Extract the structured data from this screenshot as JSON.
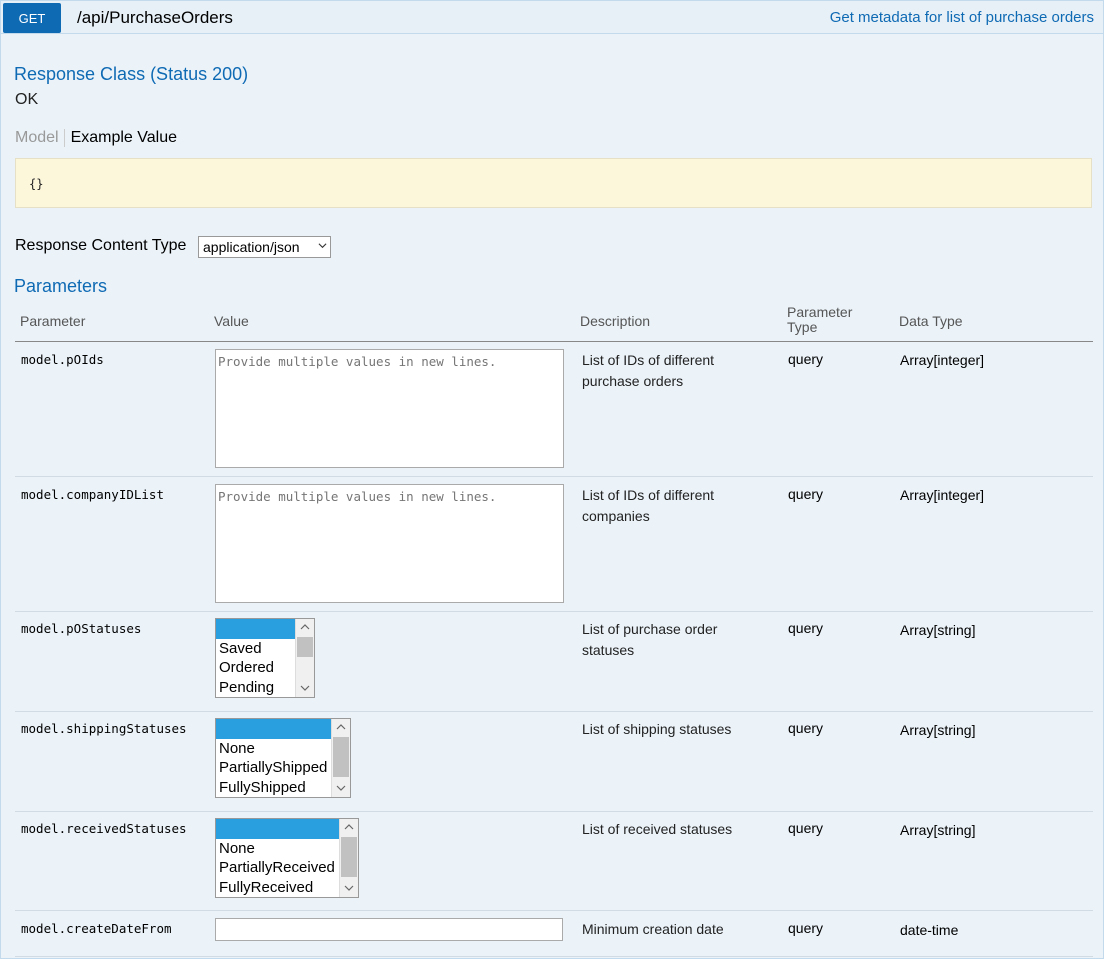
{
  "endpoint": {
    "method": "GET",
    "path": "/api/PurchaseOrders",
    "summary": "Get metadata for list of purchase orders"
  },
  "response_class": {
    "title": "Response Class (Status 200)",
    "status_text": "OK",
    "tab_model": "Model",
    "tab_example": "Example Value",
    "example_value": "{}"
  },
  "response_content_type": {
    "label": "Response Content Type",
    "selected": "application/json"
  },
  "parameters": {
    "title": "Parameters",
    "headers": {
      "parameter": "Parameter",
      "value": "Value",
      "description": "Description",
      "parameter_type_1": "Parameter",
      "parameter_type_2": "Type",
      "data_type": "Data Type"
    },
    "rows": [
      {
        "name": "model.pOIds",
        "placeholder": "Provide multiple values in new lines.",
        "description": "List of IDs of different purchase orders",
        "param_type": "query",
        "data_type": "Array[integer]"
      },
      {
        "name": "model.companyIDList",
        "placeholder": "Provide multiple values in new lines.",
        "description": "List of IDs of different companies",
        "param_type": "query",
        "data_type": "Array[integer]"
      },
      {
        "name": "model.pOStatuses",
        "options": [
          "",
          "Saved",
          "Ordered",
          "Pending"
        ],
        "description": "List of purchase order statuses",
        "param_type": "query",
        "data_type": "Array[string]"
      },
      {
        "name": "model.shippingStatuses",
        "options": [
          "",
          "None",
          "PartiallyShipped",
          "FullyShipped"
        ],
        "description": "List of shipping statuses",
        "param_type": "query",
        "data_type": "Array[string]"
      },
      {
        "name": "model.receivedStatuses",
        "options": [
          "",
          "None",
          "PartiallyReceived",
          "FullyReceived"
        ],
        "description": "List of received statuses",
        "param_type": "query",
        "data_type": "Array[string]"
      },
      {
        "name": "model.createDateFrom",
        "value": "",
        "description": "Minimum creation date",
        "param_type": "query",
        "data_type": "date-time"
      }
    ]
  },
  "colors": {
    "accent": "#0f6ab4",
    "panel_bg": "#ebf3f9",
    "example_bg": "#fcf6db",
    "selected_option": "#2a9fe0"
  }
}
